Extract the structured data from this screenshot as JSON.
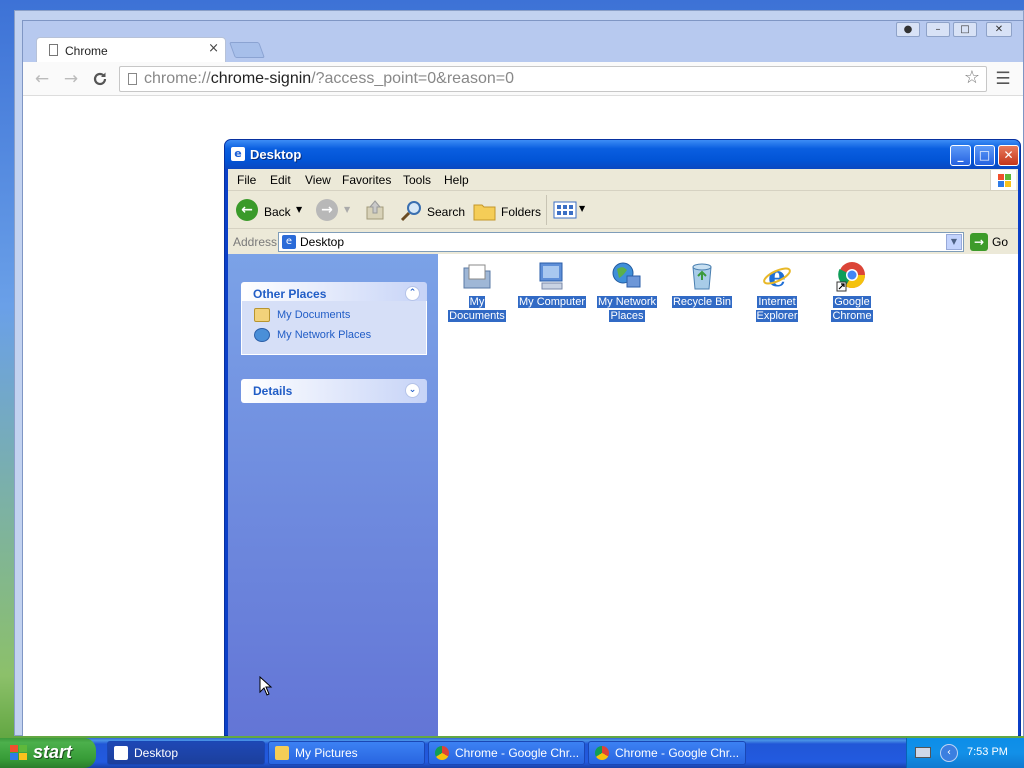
{
  "chrome": {
    "tab_title": "Chrome",
    "tab_close": "×",
    "url_scheme": "chrome://",
    "url_host": "chrome-signin",
    "url_rest": "/?access_point=0&reason=0",
    "back_icon": "←",
    "forward_icon": "→",
    "reload_icon": "C",
    "star_icon": "☆",
    "menu_icon": "☰",
    "window_buttons": [
      "–",
      "□",
      "✕"
    ]
  },
  "explorer": {
    "title": "Desktop",
    "menu": [
      "File",
      "Edit",
      "View",
      "Favorites",
      "Tools",
      "Help"
    ],
    "toolbar": {
      "back": "Back",
      "search": "Search",
      "folders": "Folders"
    },
    "address_label": "Address",
    "address_value": "Desktop",
    "go_label": "Go",
    "other_places": {
      "title": "Other Places",
      "items": [
        "My Documents",
        "My Network Places"
      ]
    },
    "details_title": "Details",
    "desktop_items": [
      {
        "label": "My Documents"
      },
      {
        "label": "My Computer"
      },
      {
        "label": "My Network Places"
      },
      {
        "label": "Recycle Bin"
      },
      {
        "label": "Internet Explorer"
      },
      {
        "label": "Google Chrome"
      }
    ]
  },
  "taskbar": {
    "start_label": "start",
    "tasks": [
      {
        "label": "Desktop",
        "active": true
      },
      {
        "label": "My Pictures",
        "active": false
      },
      {
        "label": "Chrome - Google Chr...",
        "active": false
      },
      {
        "label": "Chrome - Google Chr...",
        "active": false
      }
    ],
    "clock": "7:53 PM"
  },
  "colors": {
    "xp_blue": "#0254d6",
    "selection": "#316ac5",
    "start_green": "#3c9a3c"
  }
}
